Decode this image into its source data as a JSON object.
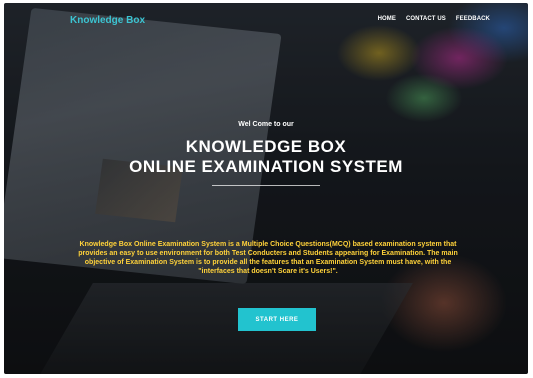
{
  "nav": {
    "brand": "Knowledge Box",
    "items": [
      "HOME",
      "CONTACT US",
      "FEEDBACK"
    ]
  },
  "hero": {
    "welcome": "Wel Come to our",
    "title_line1": "KNOWLEDGE BOX",
    "title_line2": "ONLINE EXAMINATION SYSTEM",
    "description": "Knowledge Box Online Examination System is a Multiple Choice Questions(MCQ) based examination system that provides an easy to use environment for both Test Conducters and Students appearing for Examination. The main objective of Examination System is to provide all the features that an Examination System must have, with the \"interfaces that doesn't Scare it's Users!\".",
    "cta_label": "START HERE"
  },
  "colors": {
    "brand": "#3cc4d2",
    "description": "#ffd23a",
    "cta_background": "#22c3cf"
  }
}
